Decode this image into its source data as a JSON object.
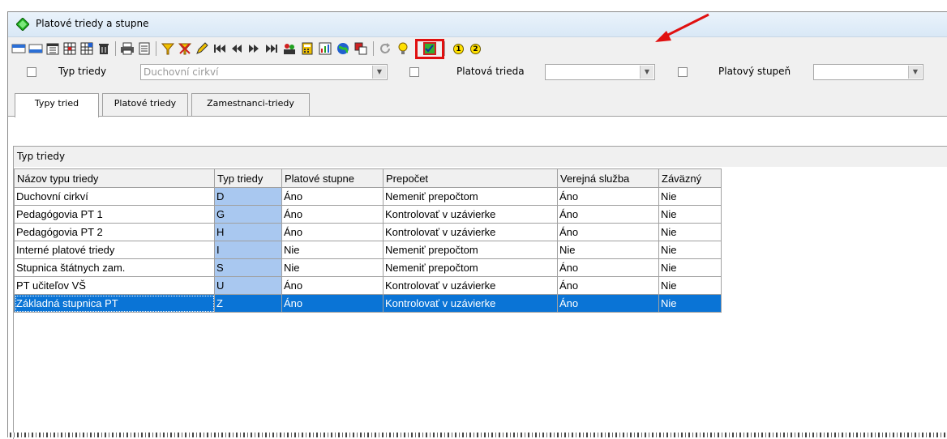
{
  "window": {
    "title": "Platové triedy a stupne"
  },
  "toolbar": {
    "icons": [
      "table-top-icon",
      "table-bottom-icon",
      "calendar-icon",
      "grid-icon",
      "grid-blue-icon",
      "trash-icon",
      "printer-icon",
      "document-icon",
      "filter-icon",
      "clear-filter-icon",
      "pencil-icon",
      "first-record-icon",
      "prev-record-icon",
      "next-record-icon",
      "last-record-icon",
      "users-icon",
      "calculator-icon",
      "chart-icon",
      "globe-icon",
      "copy-red-icon",
      "refresh-icon",
      "bulb-icon",
      "checklist-icon",
      "circle-one-icon",
      "circle-two-icon"
    ],
    "circle1": "1",
    "circle2": "2"
  },
  "filters": {
    "typ_triedy_label": "Typ triedy",
    "typ_triedy_value": "Duchovní cirkví",
    "platova_trieda_label": "Platová trieda",
    "platova_trieda_value": "",
    "platovy_stupen_label": "Platový stupeň",
    "platovy_stupen_value": ""
  },
  "tabs": [
    {
      "label": "Typy tried"
    },
    {
      "label": "Platové triedy"
    },
    {
      "label": "Zamestnanci-triedy"
    }
  ],
  "group_header": "Typ triedy",
  "table": {
    "columns": [
      "Názov typu triedy",
      "Typ triedy",
      "Platové stupne",
      "Prepočet",
      "Verejná služba",
      "Záväzný"
    ],
    "rows": [
      [
        "Duchovní cirkví",
        "D",
        "Áno",
        "Nemeniť prepočtom",
        "Áno",
        "Nie"
      ],
      [
        "Pedagógovia PT 1",
        "G",
        "Áno",
        "Kontrolovať v uzávierke",
        "Áno",
        "Nie"
      ],
      [
        "Pedagógovia PT 2",
        "H",
        "Áno",
        "Kontrolovať v uzávierke",
        "Áno",
        "Nie"
      ],
      [
        "Interné platové triedy",
        "I",
        "Nie",
        "Nemeniť prepočtom",
        "Nie",
        "Nie"
      ],
      [
        "Stupnica štátnych zam.",
        "S",
        "Nie",
        "Nemeniť prepočtom",
        "Áno",
        "Nie"
      ],
      [
        "PT učiteľov VŠ",
        "U",
        "Áno",
        "Kontrolovať v uzávierke",
        "Áno",
        "Nie"
      ],
      [
        "Základná stupnica PT",
        "Z",
        "Áno",
        "Kontrolovať v uzávierke",
        "Áno",
        "Nie"
      ]
    ],
    "selected_row": 6
  },
  "colors": {
    "selection": "#0a74d6",
    "code_column": "#a9c8f0",
    "highlight": "#e01010"
  }
}
